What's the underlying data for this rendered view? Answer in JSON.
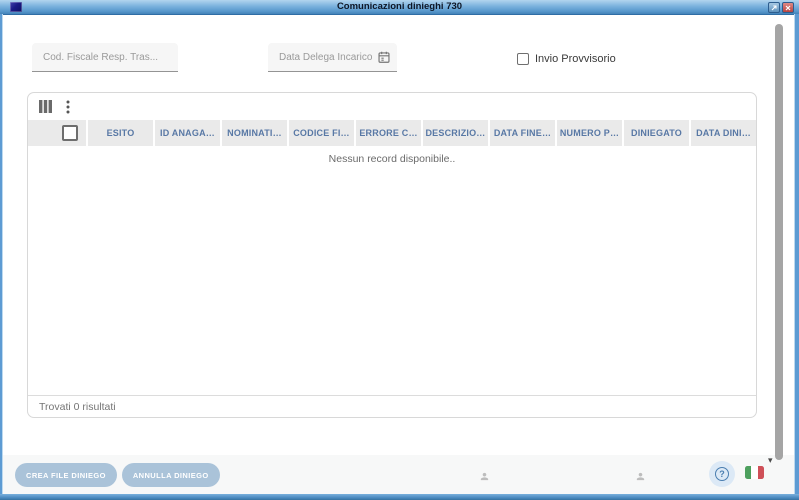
{
  "window": {
    "title": "Comunicazioni dinieghi 730"
  },
  "icons": {
    "app": "app-logo",
    "maximize": "maximize-arrow",
    "close": "close-x",
    "calendar": "date-range",
    "columns": "view-columns",
    "menu": "more-vert",
    "person": "person",
    "help": "?",
    "caret": "▾",
    "flag": "italian-flag"
  },
  "filters": {
    "cod_fiscale_placeholder": "Cod. Fiscale Resp. Tras...",
    "data_delega_placeholder": "Data Delega Incarico",
    "invio_provvisorio_label": "Invio Provvisorio",
    "invio_provvisorio_checked": false
  },
  "grid": {
    "columns": [
      "ESITO",
      "ID ANAGA…",
      "NOMINATI…",
      "CODICE FI…",
      "ERRORE C…",
      "DESCRIZIO…",
      "DATA FINE…",
      "NUMERO P…",
      "DINIEGATO",
      "DATA DINI…"
    ],
    "rows": [],
    "empty_message": "Nessun record disponibile..",
    "footer_text": "Trovati 0 risultati",
    "select_all_checked": false
  },
  "actions": {
    "crea_file_diniego": "CREA FILE DINIEGO",
    "annulla_diniego": "ANNULLA DINIEGO"
  },
  "colors": {
    "titlebar_top": "#b3d5ee",
    "titlebar_bottom": "#4383b8",
    "frame": "#5d9bd3",
    "header_text": "#5878a5",
    "header_cell_bg": "#eaeaea",
    "button_bg": "#aac3d9",
    "close_button": "#b84340",
    "flag_green": "#4da05e",
    "flag_red": "#cf5058",
    "help_accent": "#4a7eb0"
  }
}
